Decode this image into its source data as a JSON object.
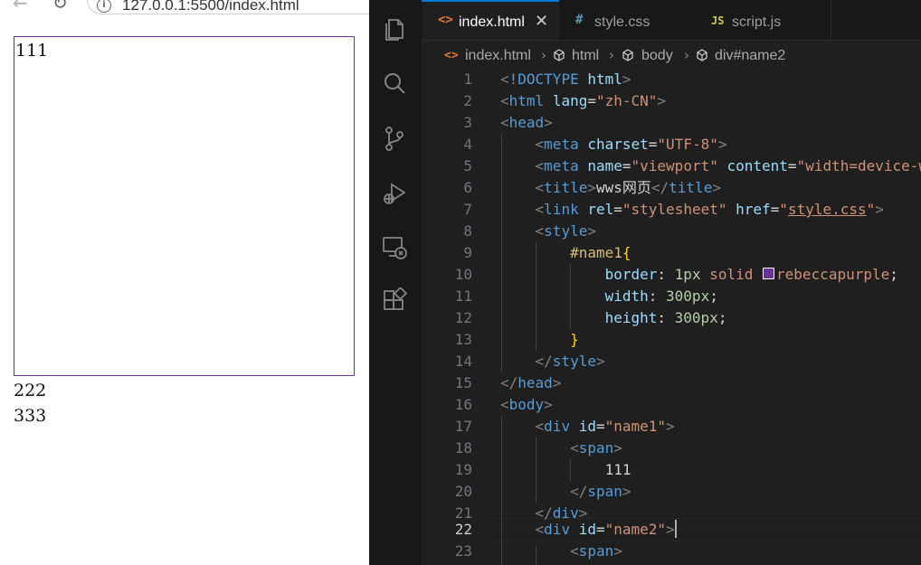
{
  "browser": {
    "url": "127.0.0.1:5500/index.html",
    "content": {
      "line1": "111",
      "line2": "222",
      "line3": "333"
    }
  },
  "vscode": {
    "tabs": [
      {
        "icon": "<>",
        "label": "index.html",
        "icon_color": "#e37933"
      },
      {
        "icon": "#",
        "label": "style.css",
        "icon_color": "#519aba"
      },
      {
        "icon": "JS",
        "label": "script.js",
        "icon_color": "#cbcb41"
      }
    ],
    "breadcrumb": [
      "index.html",
      "html",
      "body",
      "div#name2"
    ],
    "current_line": 22,
    "lines": [
      {
        "n": "1"
      },
      {
        "n": "2"
      },
      {
        "n": "3"
      },
      {
        "n": "4"
      },
      {
        "n": "5"
      },
      {
        "n": "6"
      },
      {
        "n": "7"
      },
      {
        "n": "8"
      },
      {
        "n": "9"
      },
      {
        "n": "10"
      },
      {
        "n": "11"
      },
      {
        "n": "12"
      },
      {
        "n": "13"
      },
      {
        "n": "14"
      },
      {
        "n": "15"
      },
      {
        "n": "16"
      },
      {
        "n": "17"
      },
      {
        "n": "18"
      },
      {
        "n": "19"
      },
      {
        "n": "20"
      },
      {
        "n": "21"
      },
      {
        "n": "22"
      },
      {
        "n": "23"
      }
    ],
    "code": {
      "l1": "!DOCTYPE",
      "l1b": "html",
      "l2": "html",
      "l2a": "lang",
      "l2v": "\"zh-CN\"",
      "l3": "head",
      "l4": "meta",
      "l4a": "charset",
      "l4v": "\"UTF-8\"",
      "l5": "meta",
      "l5a": "name",
      "l5v": "\"viewport\"",
      "l5b": "content",
      "l5w": "\"width=device-w",
      "l6": "title",
      "l6t": "wws网页",
      "l6c": "title",
      "l7": "link",
      "l7a": "rel",
      "l7v": "\"stylesheet\"",
      "l7b": "href",
      "l7w": "style.css",
      "l8": "style",
      "l9": "#name1",
      "l10p": "border",
      "l10v1": "1px",
      "l10v2": "solid",
      "l10v3": "rebeccapurple",
      "l11p": "width",
      "l11v": "300px",
      "l12p": "height",
      "l12v": "300px",
      "l14": "style",
      "l15": "head",
      "l16": "body",
      "l17": "div",
      "l17a": "id",
      "l17v": "\"name1\"",
      "l18": "span",
      "l19": "111",
      "l20": "span",
      "l21": "div",
      "l22": "div",
      "l22a": "id",
      "l22v": "\"name2\"",
      "l23": "span"
    }
  }
}
